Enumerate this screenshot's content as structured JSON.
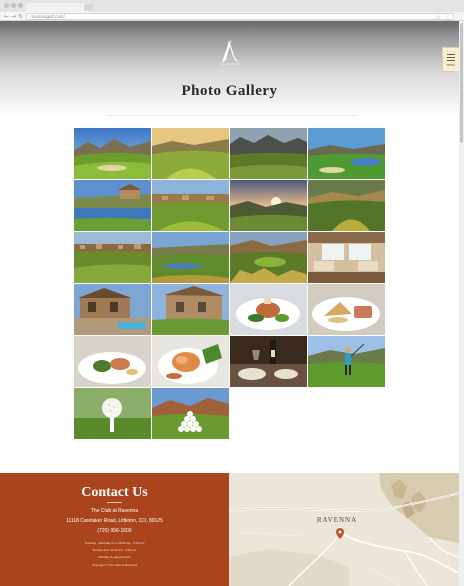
{
  "browser": {
    "url": "ravennagolf.com/"
  },
  "header": {
    "menu_label": "MENU"
  },
  "page": {
    "title": "Photo Gallery"
  },
  "gallery": {
    "photos": [
      {
        "name": "mountain-golf-course"
      },
      {
        "name": "sunlit-fairway"
      },
      {
        "name": "mountain-valley-course"
      },
      {
        "name": "green-with-pond"
      },
      {
        "name": "clubhouse-over-lake"
      },
      {
        "name": "course-and-homes"
      },
      {
        "name": "sunset-over-hills"
      },
      {
        "name": "evening-fairway"
      },
      {
        "name": "homes-on-fairway"
      },
      {
        "name": "lake-and-fairway"
      },
      {
        "name": "green-among-rocks"
      },
      {
        "name": "clubhouse-interior"
      },
      {
        "name": "clubhouse-patio"
      },
      {
        "name": "stone-clubhouse"
      },
      {
        "name": "plated-entree"
      },
      {
        "name": "sandwich-plate"
      },
      {
        "name": "appetizer-plate"
      },
      {
        "name": "seafood-dish"
      },
      {
        "name": "wine-dinner"
      },
      {
        "name": "golfer-swing"
      },
      {
        "name": "golf-ball-on-tee"
      },
      {
        "name": "pyramid-of-golf-balls"
      }
    ]
  },
  "footer": {
    "contact_title": "Contact Us",
    "club_name": "The Club at Ravenna",
    "address": "11118 Caretaker Road, Littleton, CO, 80125",
    "phone": "(720) 956-1600",
    "hours_1": "Tuesday - Saturday from 10:00 am - 5:00 pm",
    "hours_2": "Sunday from 11:00 am - 3:00 pm",
    "hours_3": "Monday by appointment",
    "copyright": "Copyright © The Club at Ravenna"
  },
  "map": {
    "label": "RAVENNA"
  },
  "colors": {
    "accent": "#a9441d",
    "menu_button": "#f6efd4",
    "map_pin": "#c0522a"
  }
}
